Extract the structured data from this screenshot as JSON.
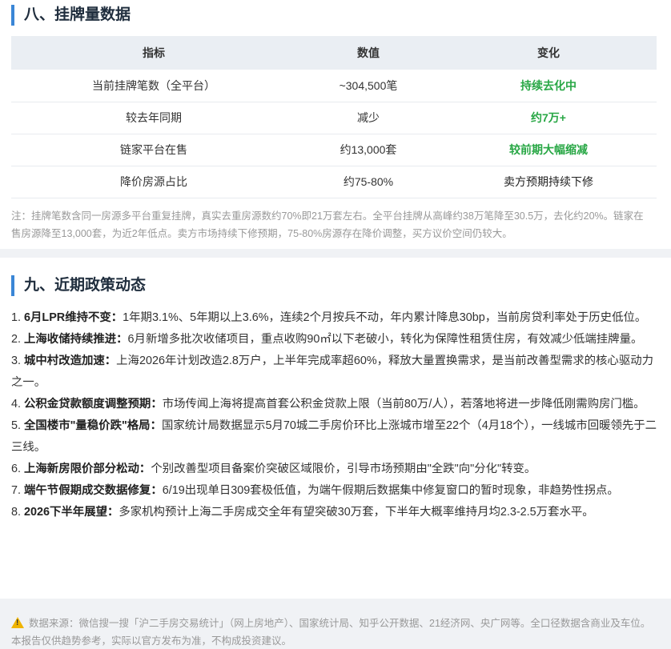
{
  "section8": {
    "title": "八、挂牌量数据",
    "table": {
      "headers": [
        "指标",
        "数值",
        "变化"
      ],
      "rows": [
        [
          "当前挂牌笔数（全平台）",
          "~304,500笔",
          "持续去化中"
        ],
        [
          "较去年同期",
          "减少",
          "约7万+"
        ],
        [
          "链家平台在售",
          "约13,000套",
          "较前期大幅缩减"
        ],
        [
          "降价房源占比",
          "约75-80%",
          "卖方预期持续下修"
        ]
      ]
    },
    "note": "注：挂牌笔数含同一房源多平台重复挂牌，真实去重房源数约70%即21万套左右。全平台挂牌从高峰约38万笔降至30.5万，去化约20%。链家在售房源降至13,000套，为近2年低点。卖方市场持续下修预期，75-80%房源存在降价调整，买方议价空间仍较大。"
  },
  "section9": {
    "title": "九、近期政策动态",
    "items": [
      {
        "num": "1.",
        "label": "6月LPR维持不变：",
        "text": "1年期3.1%、5年期以上3.6%，连续2个月按兵不动，年内累计降息30bp，当前房贷利率处于历史低位。"
      },
      {
        "num": "2.",
        "label": "上海收储持续推进：",
        "text": "6月新增多批次收储项目，重点收购90㎡以下老破小，转化为保障性租赁住房，有效减少低端挂牌量。"
      },
      {
        "num": "3.",
        "label": "城中村改造加速：",
        "text": "上海2026年计划改造2.8万户，上半年完成率超60%，释放大量置换需求，是当前改善型需求的核心驱动力之一。"
      },
      {
        "num": "4.",
        "label": "公积金贷款额度调整预期：",
        "text": "市场传闻上海将提高首套公积金贷款上限（当前80万/人），若落地将进一步降低刚需购房门槛。"
      },
      {
        "num": "5.",
        "label": "全国楼市\"量稳价跌\"格局：",
        "text": "国家统计局数据显示5月70城二手房价环比上涨城市增至22个（4月18个），一线城市回暖领先于二三线。"
      },
      {
        "num": "6.",
        "label": "上海新房限价部分松动：",
        "text": "个别改善型项目备案价突破区域限价，引导市场预期由\"全跌\"向\"分化\"转变。"
      },
      {
        "num": "7.",
        "label": "端午节假期成交数据修复：",
        "text": "6/19出现单日309套极低值，为端午假期后数据集中修复窗口的暂时现象，非趋势性拐点。"
      },
      {
        "num": "8.",
        "label": "2026下半年展望：",
        "text": "多家机构预计上海二手房成交全年有望突破30万套，下半年大概率维持月均2.3-2.5万套水平。"
      }
    ]
  },
  "footer": {
    "icon": "warning-icon",
    "text": "数据来源：微信搜一搜「沪二手房交易统计」（网上房地产）、国家统计局、知乎公开数据、21经济网、央广网等。全口径数据含商业及车位。本报告仅供趋势参考，实际以官方发布为准，不构成投资建议。"
  },
  "colors": {
    "accent": "#3a86d6",
    "positive": "#28a745",
    "warning": "#f0b400"
  }
}
